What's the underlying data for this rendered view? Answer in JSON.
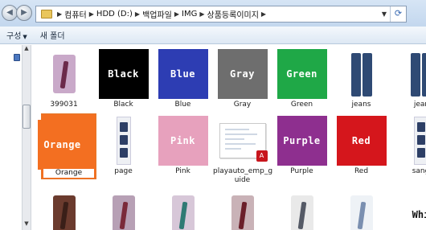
{
  "address": {
    "crumbs": [
      "컴퓨터",
      "HDD (D:)",
      "백업파일",
      "IMG",
      "상품등록이미지"
    ],
    "separator": "▶",
    "dropdown_glyph": "▼",
    "refresh_glyph": "⟳"
  },
  "nav": {
    "back_glyph": "◀",
    "forward_glyph": "▶"
  },
  "toolbar": {
    "organize_label": "구성",
    "organize_caret": "▼",
    "new_folder_label": "새 폴더"
  },
  "scroll": {
    "up_glyph": "▲",
    "down_glyph": "▼"
  },
  "items": [
    {
      "label": "399031",
      "kind": "photo-shirt",
      "shirt_color": "#c9a9c9",
      "tie_color": "#6b2a4b"
    },
    {
      "label": "Black",
      "kind": "swatch",
      "text": "Black",
      "color": "#000000"
    },
    {
      "label": "Blue",
      "kind": "swatch",
      "text": "Blue",
      "color": "#2d3db3"
    },
    {
      "label": "Gray",
      "kind": "swatch",
      "text": "Gray",
      "color": "#6e6e6e"
    },
    {
      "label": "Green",
      "kind": "swatch",
      "text": "Green",
      "color": "#1fa847"
    },
    {
      "label": "jeans",
      "kind": "photo-jeans"
    },
    {
      "label": "jear",
      "kind": "photo-jeans"
    },
    {
      "label": "Orange",
      "kind": "swatch",
      "text": "Orange",
      "color": "#f36f21",
      "selected": true
    },
    {
      "label": "page",
      "kind": "photo-strip"
    },
    {
      "label": "Pink",
      "kind": "swatch",
      "text": "Pink",
      "color": "#e7a1bd"
    },
    {
      "label": "playauto_emp_g\nuide",
      "kind": "pdf",
      "badge": "A"
    },
    {
      "label": "Purple",
      "kind": "swatch",
      "text": "Purple",
      "color": "#8e2f8f"
    },
    {
      "label": "Red",
      "kind": "swatch",
      "text": "Red",
      "color": "#d5161c"
    },
    {
      "label": "sang",
      "kind": "photo-strip"
    },
    {
      "label": "",
      "kind": "photo-shirt",
      "shirt_color": "#6b3b2e",
      "tie_color": "#3a1f18"
    },
    {
      "label": "",
      "kind": "photo-shirt",
      "shirt_color": "#b7a0b5",
      "tie_color": "#7a2a3a"
    },
    {
      "label": "",
      "kind": "photo-shirt",
      "shirt_color": "#d7c7d8",
      "tie_color": "#2f7a74"
    },
    {
      "label": "",
      "kind": "photo-shirt",
      "shirt_color": "#c9b2b7",
      "tie_color": "#6b1f2a"
    },
    {
      "label": "",
      "kind": "photo-shirt",
      "shirt_color": "#e9e9e9",
      "tie_color": "#555a66"
    },
    {
      "label": "",
      "kind": "photo-shirt",
      "shirt_color": "#eef2f6",
      "tie_color": "#7a8fb0"
    },
    {
      "label": "",
      "kind": "white",
      "text": "Whi"
    }
  ]
}
